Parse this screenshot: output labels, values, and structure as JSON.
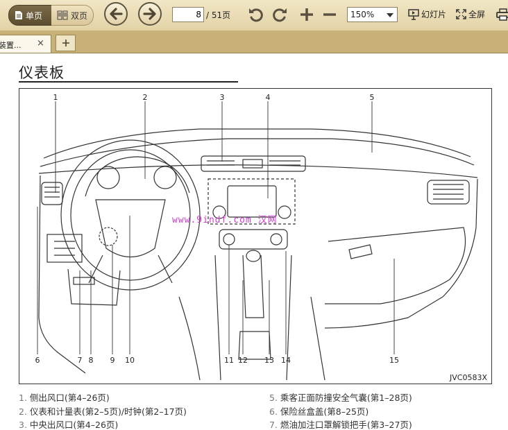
{
  "toolbar": {
    "single_page_label": "单页",
    "double_page_label": "双页",
    "current_page": "8",
    "total_pages": "/ 51页",
    "zoom": "150%",
    "slideshow_label": "幻灯片",
    "fullscreen_label": "全屏"
  },
  "tabs": [
    {
      "label": "装置...",
      "close": "×"
    }
  ],
  "tab_add": "+",
  "document": {
    "title": "仪表板",
    "figure_code": "JVC0583X",
    "watermark": "www.9indf.com 汉网",
    "callouts": [
      "1",
      "2",
      "3",
      "4",
      "5",
      "6",
      "7",
      "8",
      "9",
      "10",
      "11",
      "12",
      "13",
      "14",
      "15"
    ],
    "legend": [
      {
        "n": "1.",
        "text": "侧出风口(第4–26页)"
      },
      {
        "n": "2.",
        "text": "仪表和计量表(第2–5页)/时钟(第2–17页)"
      },
      {
        "n": "3.",
        "text": "中央出风口(第4–26页)"
      },
      {
        "n": "5.",
        "text": "乘客正面防撞安全气囊(第1–28页)"
      },
      {
        "n": "6.",
        "text": "保险丝盒盖(第8–25页)"
      },
      {
        "n": "7.",
        "text": "燃油加注口罩解锁把手(第3–27页)"
      }
    ]
  },
  "colors": {
    "toolbar_bg": "#e9dcb5",
    "tabbar_bg": "#c7b179",
    "active_segment": "#6b5b3c",
    "watermark": "#d23bd2"
  }
}
